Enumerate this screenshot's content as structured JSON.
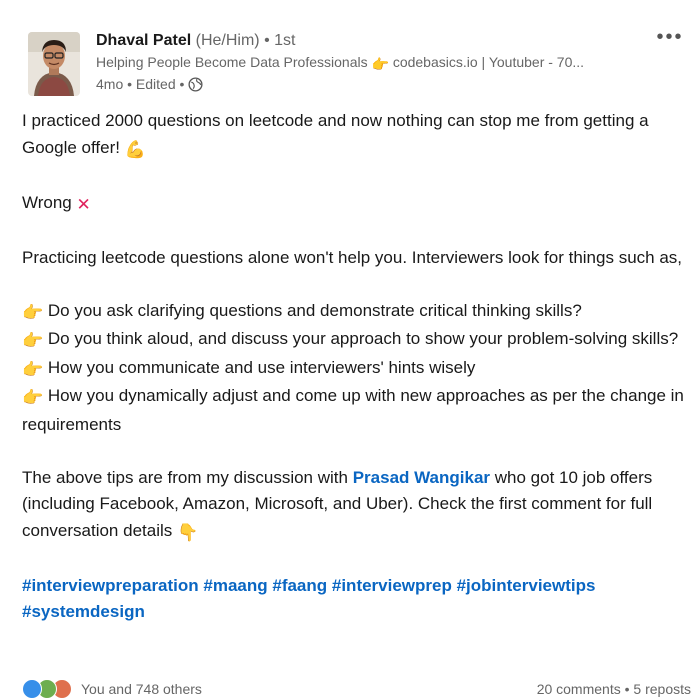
{
  "author": {
    "name": "Dhaval Patel",
    "pronouns": "(He/Him)",
    "degree": "• 1st",
    "headline_pre": "Helping People Become Data Professionals",
    "headline_post": "codebasics.io | Youtuber - 70...",
    "time": "4mo • Edited •"
  },
  "more_label": "•••",
  "body": {
    "p1": "I practiced 2000 questions on leetcode and now nothing can stop me from getting a Google offer!",
    "p2": "Wrong",
    "p3": "Practicing leetcode questions alone won't help you. Interviewers look for things such as,",
    "bullets": [
      "Do you ask clarifying questions and demonstrate critical thinking skills?",
      "Do you think aloud, and discuss your approach to show your problem-solving skills?",
      "How you communicate and use interviewers' hints wisely",
      "How you dynamically adjust and come up with new approaches as per the change in requirements"
    ],
    "p5_pre": "The above tips are from my discussion with",
    "mention": "Prasad Wangikar",
    "p5_post": "who got 10 job offers (including Facebook, Amazon, Microsoft, and Uber). Check the first comment for full conversation details",
    "hashtags": "#interviewpreparation #maang #faang #interviewprep #jobinterviewtips #systemdesign"
  },
  "social": {
    "likes": "You and 748 others",
    "stats": "20 comments • 5 reposts"
  },
  "colors": {
    "link": "#0a66c2",
    "secondary_text": "#666666",
    "like": "#378fe9",
    "celebrate": "#6dae4f",
    "love": "#df704d"
  }
}
